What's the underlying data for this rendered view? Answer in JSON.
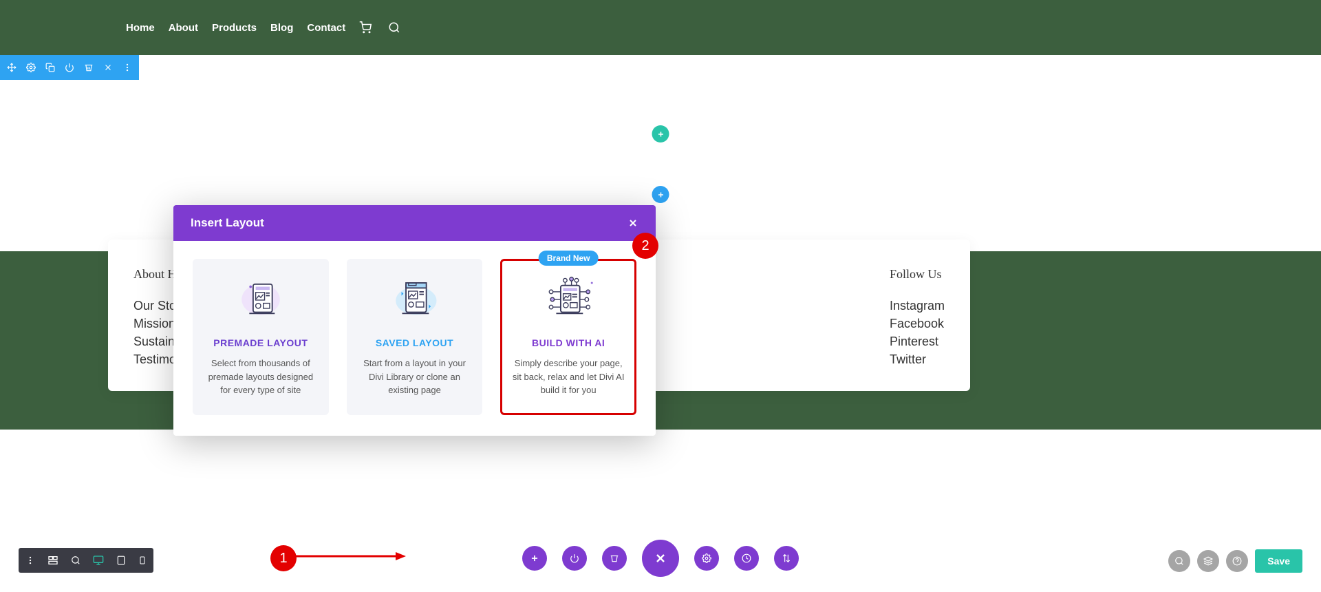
{
  "nav": {
    "items": [
      "Home",
      "About",
      "Products",
      "Blog",
      "Contact"
    ]
  },
  "modal": {
    "title": "Insert Layout",
    "badge": "Brand New",
    "cards": [
      {
        "title": "PREMADE LAYOUT",
        "desc": "Select from thousands of premade layouts designed for every type of site"
      },
      {
        "title": "SAVED LAYOUT",
        "desc": "Start from a layout in your Divi Library or clone an existing page"
      },
      {
        "title": "BUILD WITH AI",
        "desc": "Simply describe your page, sit back, relax and let Divi AI build it for you"
      }
    ]
  },
  "footer": {
    "left_heading": "About H",
    "left_links": [
      "Our Stor",
      "Mission",
      "Sustaina",
      "Testimor"
    ],
    "right_heading": "Follow Us",
    "right_links": [
      "Instagram",
      "Facebook",
      "Pinterest",
      "Twitter"
    ]
  },
  "save_label": "Save",
  "annotations": {
    "a1": "1",
    "a2": "2"
  }
}
